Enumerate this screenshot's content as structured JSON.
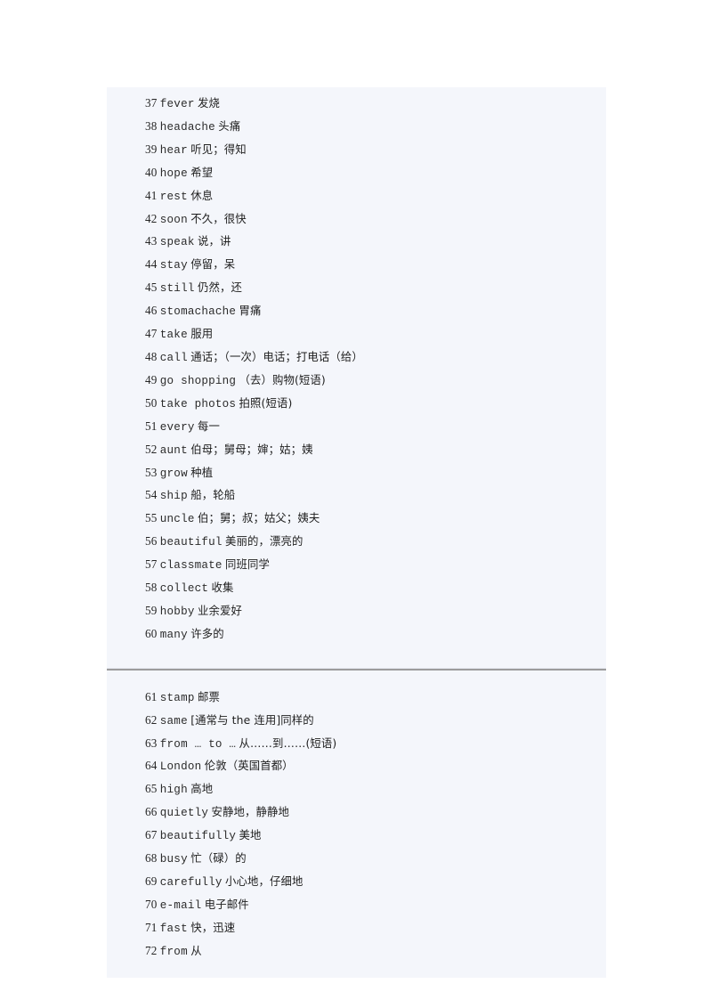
{
  "document": {
    "type": "vocabulary-list",
    "background_color": "#f4f6fb",
    "page_background": "#ffffff",
    "divider_color": "#9c9c9c",
    "sections": [
      {
        "id": "section-upper",
        "entries": [
          {
            "number": "37",
            "english": "fever",
            "chinese": "发烧"
          },
          {
            "number": "38",
            "english": "headache",
            "chinese": "头痛"
          },
          {
            "number": "39",
            "english": "hear",
            "chinese": "听见；得知"
          },
          {
            "number": "40",
            "english": "hope",
            "chinese": "希望"
          },
          {
            "number": "41",
            "english": "rest",
            "chinese": "休息"
          },
          {
            "number": "42",
            "english": "soon",
            "chinese": "不久，很快"
          },
          {
            "number": "43",
            "english": "speak",
            "chinese": "说，讲"
          },
          {
            "number": "44",
            "english": "stay",
            "chinese": "停留，呆"
          },
          {
            "number": "45",
            "english": "still",
            "chinese": "仍然，还"
          },
          {
            "number": "46",
            "english": "stomachache",
            "chinese": "胃痛"
          },
          {
            "number": "47",
            "english": "take",
            "chinese": "服用"
          },
          {
            "number": "48",
            "english": "call",
            "chinese": "通话；（一次）电话；打电话（给）"
          },
          {
            "number": "49",
            "english": "go shopping",
            "chinese": "（去）购物(短语)"
          },
          {
            "number": "50",
            "english": "take photos",
            "chinese": "拍照(短语)"
          },
          {
            "number": "51",
            "english": "every",
            "chinese": "每一"
          },
          {
            "number": "52",
            "english": "aunt",
            "chinese": "伯母；舅母；婶；姑；姨"
          },
          {
            "number": "53",
            "english": "grow",
            "chinese": "种植"
          },
          {
            "number": "54",
            "english": "ship",
            "chinese": "船，轮船"
          },
          {
            "number": "55",
            "english": "uncle",
            "chinese": "伯；舅；叔；姑父；姨夫"
          },
          {
            "number": "56",
            "english": "beautiful",
            "chinese": "美丽的，漂亮的"
          },
          {
            "number": "57",
            "english": "classmate",
            "chinese": "同班同学"
          },
          {
            "number": "58",
            "english": "collect",
            "chinese": "收集"
          },
          {
            "number": "59",
            "english": "hobby",
            "chinese": "业余爱好"
          },
          {
            "number": "60",
            "english": "many",
            "chinese": "许多的"
          }
        ]
      },
      {
        "id": "section-lower",
        "entries": [
          {
            "number": "61",
            "english": "stamp",
            "chinese": "邮票"
          },
          {
            "number": "62",
            "english": "same",
            "chinese": "[通常与 the 连用]同样的"
          },
          {
            "number": "63",
            "english": "from … to …",
            "chinese": "从……到……(短语)"
          },
          {
            "number": "64",
            "english": "London",
            "chinese": "伦敦（英国首都）"
          },
          {
            "number": "65",
            "english": "high",
            "chinese": "高地"
          },
          {
            "number": "66",
            "english": "quietly",
            "chinese": "安静地，静静地"
          },
          {
            "number": "67",
            "english": "beautifully",
            "chinese": "美地"
          },
          {
            "number": "68",
            "english": "busy",
            "chinese": "忙（碌）的"
          },
          {
            "number": "69",
            "english": "carefully",
            "chinese": "小心地，仔细地"
          },
          {
            "number": "70",
            "english": "e-mail",
            "chinese": "电子邮件"
          },
          {
            "number": "71",
            "english": "fast",
            "chinese": "快，迅速"
          },
          {
            "number": "72",
            "english": "from",
            "chinese": "从"
          }
        ]
      }
    ]
  }
}
